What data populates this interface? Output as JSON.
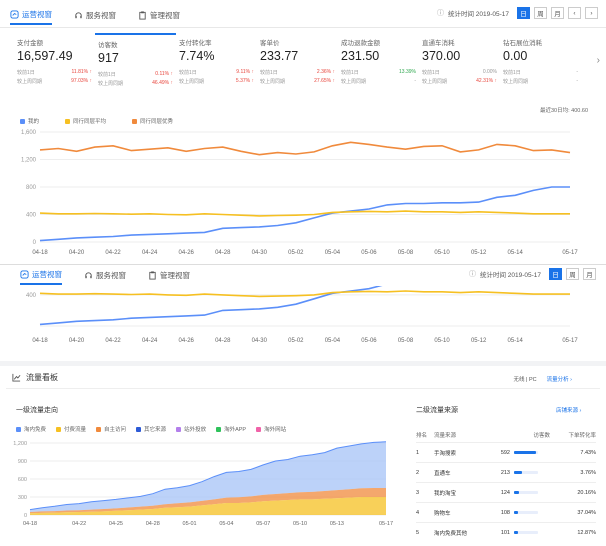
{
  "top_tabs": [
    {
      "label": "运营视窗",
      "icon": "chart-icon",
      "active": true
    },
    {
      "label": "服务视窗",
      "icon": "headset-icon",
      "active": false
    },
    {
      "label": "管理视窗",
      "icon": "clipboard-icon",
      "active": false
    }
  ],
  "toolbar": {
    "date_label": "统计时间 2019-05-17",
    "periods": [
      "日",
      "周",
      "月"
    ],
    "prev": "‹",
    "next": "›"
  },
  "cards": [
    {
      "title": "支付金额",
      "value": "16,597.49",
      "r1_label": "较前1日",
      "r1_val": "11.81%",
      "r2_label": "较上周同期",
      "r2_val": "97.03%"
    },
    {
      "title": "访客数",
      "value": "917",
      "r1_label": "较前1日",
      "r1_val": "0.11%",
      "r2_label": "较上周同期",
      "r2_val": "46.49%"
    },
    {
      "title": "支付转化率",
      "value": "7.74%",
      "r1_label": "较前1日",
      "r1_val": "9.11%",
      "r2_label": "较上周同期",
      "r2_val": "5.37%"
    },
    {
      "title": "客单价",
      "value": "233.77",
      "r1_label": "较前1日",
      "r1_val": "2.36%",
      "r2_label": "较上周同期",
      "r2_val": "27.65%"
    },
    {
      "title": "成功退款金额",
      "value": "231.50",
      "r1_label": "较前1日",
      "r1_val": "13.39%",
      "r2_label": "较上周同期",
      "r2_val": "-"
    },
    {
      "title": "直通车消耗",
      "value": "370.00",
      "r1_label": "较前1日",
      "r1_val": "0.00%",
      "r2_label": "较上周同期",
      "r2_val": "42.31%"
    },
    {
      "title": "钻石展位消耗",
      "value": "0.00",
      "r1_label": "较前1日",
      "r1_val": "-",
      "r2_label": "较上周同期",
      "r2_val": "-"
    }
  ],
  "main_legend": [
    {
      "label": "我的",
      "color": "#5b8ff9"
    },
    {
      "label": "同行同层平均",
      "color": "#f6c022"
    },
    {
      "label": "同行同层优秀",
      "color": "#f08a3c"
    }
  ],
  "recent_label": "最近30日均: 400.60",
  "chart_data": [
    {
      "type": "line",
      "x": [
        "04-18",
        "04-19",
        "04-20",
        "04-21",
        "04-22",
        "04-23",
        "04-24",
        "04-25",
        "04-26",
        "04-27",
        "04-28",
        "04-29",
        "04-30",
        "05-01",
        "05-02",
        "05-03",
        "05-04",
        "05-05",
        "05-06",
        "05-07",
        "05-08",
        "05-09",
        "05-10",
        "05-11",
        "05-12",
        "05-13",
        "05-14",
        "05-15",
        "05-16",
        "05-17"
      ],
      "xticks": [
        "04-18",
        "04-20",
        "04-22",
        "04-24",
        "04-26",
        "04-28",
        "04-30",
        "05-02",
        "05-04",
        "05-06",
        "05-08",
        "05-10",
        "05-12",
        "05-14",
        "05-17"
      ],
      "yticks": [
        0,
        400,
        800,
        1200,
        1600
      ],
      "ylim": [
        0,
        1600
      ],
      "series": [
        {
          "name": "我的",
          "color": "#5b8ff9",
          "values": [
            20,
            40,
            60,
            70,
            80,
            100,
            110,
            120,
            130,
            140,
            200,
            210,
            220,
            240,
            280,
            350,
            420,
            450,
            480,
            540,
            560,
            560,
            570,
            570,
            580,
            650,
            680,
            750,
            800,
            800
          ]
        },
        {
          "name": "同行同层平均",
          "color": "#f6c022",
          "values": [
            420,
            410,
            410,
            415,
            410,
            405,
            410,
            400,
            395,
            410,
            400,
            390,
            380,
            385,
            390,
            400,
            430,
            440,
            445,
            440,
            450,
            440,
            440,
            430,
            440,
            430,
            420,
            410,
            410,
            410
          ]
        },
        {
          "name": "同行同层优秀",
          "color": "#f08a3c",
          "values": [
            1340,
            1360,
            1320,
            1380,
            1400,
            1330,
            1350,
            1370,
            1320,
            1360,
            1380,
            1320,
            1270,
            1300,
            1280,
            1310,
            1400,
            1450,
            1420,
            1380,
            1350,
            1390,
            1400,
            1310,
            1340,
            1420,
            1400,
            1330,
            1340,
            1300
          ]
        }
      ]
    },
    {
      "type": "area",
      "x": [
        "04-18",
        "04-19",
        "04-20",
        "04-21",
        "04-22",
        "04-23",
        "04-24",
        "04-25",
        "04-26",
        "04-27",
        "04-28",
        "04-29",
        "04-30",
        "05-01",
        "05-02",
        "05-03",
        "05-04",
        "05-05",
        "05-06",
        "05-07",
        "05-08",
        "05-09",
        "05-10",
        "05-11",
        "05-12",
        "05-13",
        "05-14",
        "05-15",
        "05-16",
        "05-17"
      ],
      "xticks": [
        "04-18",
        "04-22",
        "04-25",
        "04-28",
        "05-01",
        "05-04",
        "05-07",
        "05-10",
        "05-13",
        "05-17"
      ],
      "yticks": [
        0,
        300,
        600,
        900,
        1200
      ],
      "ylim": [
        0,
        1200
      ],
      "series": [
        {
          "name": "付费流量",
          "color": "#f6c022",
          "values": [
            30,
            35,
            40,
            45,
            50,
            55,
            60,
            70,
            80,
            90,
            100,
            120,
            130,
            140,
            160,
            180,
            200,
            200,
            210,
            230,
            240,
            250,
            260,
            260,
            270,
            280,
            290,
            300,
            300,
            300
          ]
        },
        {
          "name": "自主访问",
          "color": "#f08a3c",
          "values": [
            20,
            25,
            25,
            30,
            30,
            35,
            40,
            40,
            45,
            50,
            55,
            60,
            65,
            70,
            75,
            80,
            90,
            95,
            100,
            105,
            110,
            115,
            120,
            125,
            130,
            135,
            140,
            145,
            150,
            150
          ]
        },
        {
          "name": "淘内免费",
          "color": "#a6c3f7",
          "values": [
            40,
            60,
            80,
            100,
            110,
            130,
            140,
            150,
            160,
            170,
            200,
            250,
            260,
            280,
            320,
            380,
            420,
            430,
            450,
            500,
            550,
            560,
            600,
            620,
            640,
            700,
            720,
            740,
            760,
            770
          ]
        }
      ]
    }
  ],
  "sub_tabs": [
    {
      "label": "运营视窗",
      "icon": "chart-icon",
      "active": true
    },
    {
      "label": "服务视窗",
      "icon": "headset-icon",
      "active": false
    },
    {
      "label": "管理视窗",
      "icon": "clipboard-icon",
      "active": false
    }
  ],
  "sub_toolbar": {
    "date_label": "统计时间 2019-05-17",
    "periods": [
      "日",
      "周",
      "月"
    ]
  },
  "sub_yticks": [
    "400",
    "0"
  ],
  "flow_board": {
    "title": "流量看板",
    "right_links": {
      "device": "无线 | PC",
      "analysis": "流量分析 ›"
    }
  },
  "level1": {
    "title": "一级流量走向",
    "legend": [
      {
        "label": "淘内免费",
        "color": "#5b8ff9"
      },
      {
        "label": "付费流量",
        "color": "#f6c022"
      },
      {
        "label": "自主访问",
        "color": "#f08a3c"
      },
      {
        "label": "其它来源",
        "color": "#2d5bd6"
      },
      {
        "label": "站外投放",
        "color": "#b37feb"
      },
      {
        "label": "淘外APP",
        "color": "#2fc25b"
      },
      {
        "label": "淘外网站",
        "color": "#f062a8"
      }
    ]
  },
  "level2": {
    "title": "二级流量来源",
    "link": "店铺来源 ›",
    "headers": [
      "排名",
      "流量来源",
      "访客数",
      "下单转化率"
    ],
    "rows": [
      {
        "rank": "1",
        "source": "手淘搜索",
        "visitors": "592",
        "pct": 0.92,
        "rate": "7.43%"
      },
      {
        "rank": "2",
        "source": "直通车",
        "visitors": "213",
        "pct": 0.33,
        "rate": "3.76%"
      },
      {
        "rank": "3",
        "source": "我的淘宝",
        "visitors": "124",
        "pct": 0.19,
        "rate": "20.16%"
      },
      {
        "rank": "4",
        "source": "购物车",
        "visitors": "108",
        "pct": 0.17,
        "rate": "37.04%"
      },
      {
        "rank": "5",
        "source": "淘内免费其他",
        "visitors": "101",
        "pct": 0.16,
        "rate": "12.87%"
      }
    ]
  }
}
